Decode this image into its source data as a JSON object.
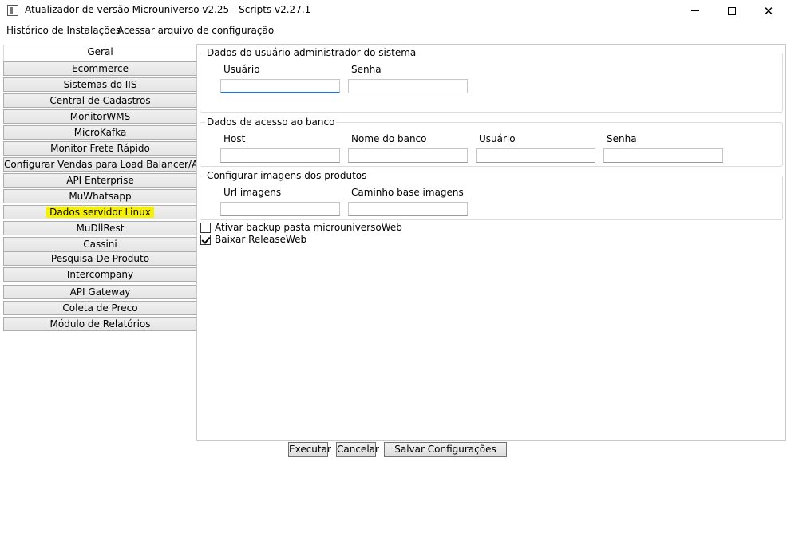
{
  "window": {
    "title": "Atualizador de versão Microuniverso v2.25 - Scripts v2.27.1",
    "icon": "app-window-icon"
  },
  "menu": {
    "items": [
      "Histórico de Instalações",
      "Acessar arquivo de configuração"
    ]
  },
  "tabs": {
    "selected": "Geral",
    "highlighted": "Dados servidor Linux",
    "items": [
      "Geral",
      "Ecommerce",
      "Sistemas do IIS",
      "Central de Cadastros",
      "MonitorWMS",
      "MicroKafka",
      "Monitor Frete Rápido",
      "Configurar Vendas para Load Balancer/AWS",
      "API Enterprise",
      "MuWhatsapp",
      "Dados servidor Linux",
      "MuDllRest",
      "Cassini",
      "Pesquisa De Produto",
      "Intercompany",
      "API Gateway",
      "Coleta de Preco",
      "Módulo de Relatórios"
    ],
    "highlight_color": "#f6f000"
  },
  "admin_group": {
    "title": "Dados do usuário administrador do sistema",
    "user_label": "Usuário",
    "user_value": "",
    "password_label": "Senha",
    "password_value": ""
  },
  "db_group": {
    "title": "Dados de acesso ao banco",
    "host_label": "Host",
    "host_value": "",
    "dbname_label": "Nome do banco",
    "dbname_value": "",
    "user_label": "Usuário",
    "user_value": "",
    "password_label": "Senha",
    "password_value": ""
  },
  "images_group": {
    "title": "Configurar imagens dos produtos",
    "url_label": "Url imagens",
    "url_value": "",
    "path_label": "Caminho base imagens",
    "path_value": ""
  },
  "checkboxes": [
    {
      "label": "Ativar backup pasta microuniversoWeb",
      "checked": false
    },
    {
      "label": "Baixar ReleaseWeb",
      "checked": true
    }
  ],
  "buttons": {
    "execute": "Executar",
    "cancel": "Cancelar",
    "save": "Salvar Configurações"
  }
}
